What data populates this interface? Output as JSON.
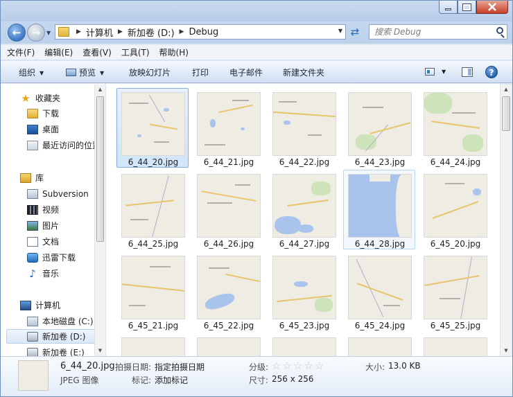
{
  "window": {
    "caption_buttons": [
      "minimize",
      "maximize",
      "close"
    ]
  },
  "address": {
    "crumbs": [
      "计算机",
      "新加卷 (D:)",
      "Debug"
    ]
  },
  "search": {
    "placeholder": "搜索 Debug"
  },
  "menu": [
    "文件(F)",
    "编辑(E)",
    "查看(V)",
    "工具(T)",
    "帮助(H)"
  ],
  "toolbar": {
    "organize": "组织",
    "preview": "预览",
    "slideshow": "放映幻灯片",
    "print": "打印",
    "email": "电子邮件",
    "new_folder": "新建文件夹"
  },
  "nav": {
    "favorites": "收藏夹",
    "downloads": "下载",
    "desktop": "桌面",
    "recent": "最近访问的位置",
    "libraries": "库",
    "subversion": "Subversion",
    "videos": "视频",
    "pictures": "图片",
    "documents": "文档",
    "xunlei": "迅雷下载",
    "music": "音乐",
    "computer": "计算机",
    "local_c": "本地磁盘 (C:)",
    "volume_d": "新加卷 (D:)",
    "volume_e": "新加卷 (E:)"
  },
  "files": [
    {
      "name": "6_44_20.jpg",
      "state": "selected"
    },
    {
      "name": "6_44_21.jpg",
      "state": "normal"
    },
    {
      "name": "6_44_22.jpg",
      "state": "normal"
    },
    {
      "name": "6_44_23.jpg",
      "state": "normal"
    },
    {
      "name": "6_44_24.jpg",
      "state": "normal"
    },
    {
      "name": "6_44_25.jpg",
      "state": "normal"
    },
    {
      "name": "6_44_26.jpg",
      "state": "normal"
    },
    {
      "name": "6_44_27.jpg",
      "state": "normal"
    },
    {
      "name": "6_44_28.jpg",
      "state": "hover"
    },
    {
      "name": "6_45_20.jpg",
      "state": "normal"
    },
    {
      "name": "6_45_21.jpg",
      "state": "normal"
    },
    {
      "name": "6_45_22.jpg",
      "state": "normal"
    },
    {
      "name": "6_45_23.jpg",
      "state": "normal"
    },
    {
      "name": "6_45_24.jpg",
      "state": "normal"
    },
    {
      "name": "6_45_25.jpg",
      "state": "normal"
    }
  ],
  "details": {
    "filename": "6_44_20.jpg",
    "filetype": "JPEG 图像",
    "date_label": "拍摄日期:",
    "date_value": "指定拍摄日期",
    "tags_label": "标记:",
    "tags_value": "添加标记",
    "rating_label": "分级:",
    "rating_stars": 0,
    "rating_max": 5,
    "dims_label": "尺寸:",
    "dims_value": "256 x 256",
    "size_label": "大小:",
    "size_value": "13.0 KB"
  },
  "colors": {
    "selection_border": "#84acdd",
    "map_land": "#efece4",
    "map_water": "#a9c4ec"
  }
}
